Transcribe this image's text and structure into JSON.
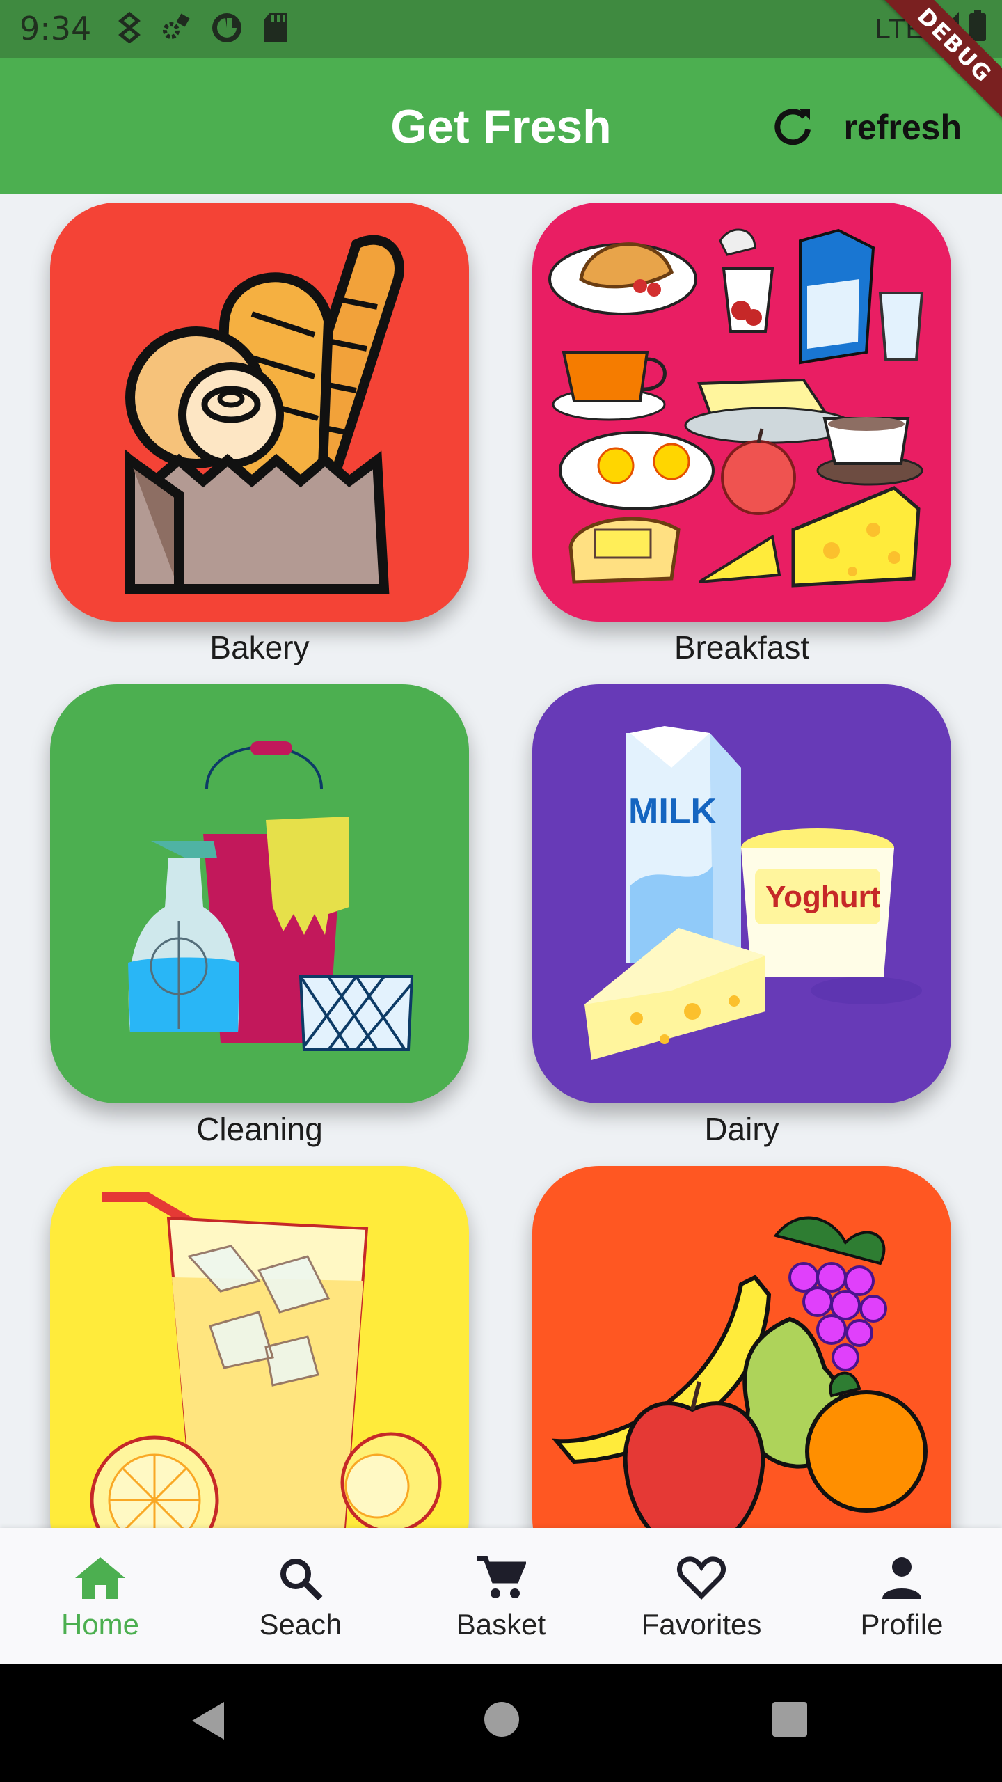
{
  "status_bar": {
    "time": "9:34",
    "network": "LTE",
    "debug_banner": "DEBUG"
  },
  "app_bar": {
    "title": "Get Fresh",
    "refresh_label": "refresh",
    "refresh_icon": "refresh-icon"
  },
  "categories": [
    {
      "label": "Bakery",
      "color": "#f44336",
      "icon": "bakery-image"
    },
    {
      "label": "Breakfast",
      "color": "#e91e63",
      "icon": "breakfast-image"
    },
    {
      "label": "Cleaning",
      "color": "#4caf50",
      "icon": "cleaning-image"
    },
    {
      "label": "Dairy",
      "color": "#673ab7",
      "icon": "dairy-image"
    },
    {
      "label": "",
      "color": "#ffeb3b",
      "icon": "drinks-image"
    },
    {
      "label": "",
      "color": "#ff5722",
      "icon": "fruit-image"
    }
  ],
  "dairy_art": {
    "milk": "MILK",
    "yoghurt": "Yoghurt"
  },
  "bottom_nav": {
    "accent": "#4caf50",
    "items": [
      {
        "label": "Home",
        "icon": "home-icon",
        "active": true
      },
      {
        "label": "Seach",
        "icon": "search-icon",
        "active": false
      },
      {
        "label": "Basket",
        "icon": "cart-icon",
        "active": false
      },
      {
        "label": "Favorites",
        "icon": "heart-icon",
        "active": false
      },
      {
        "label": "Profile",
        "icon": "person-icon",
        "active": false
      }
    ]
  }
}
